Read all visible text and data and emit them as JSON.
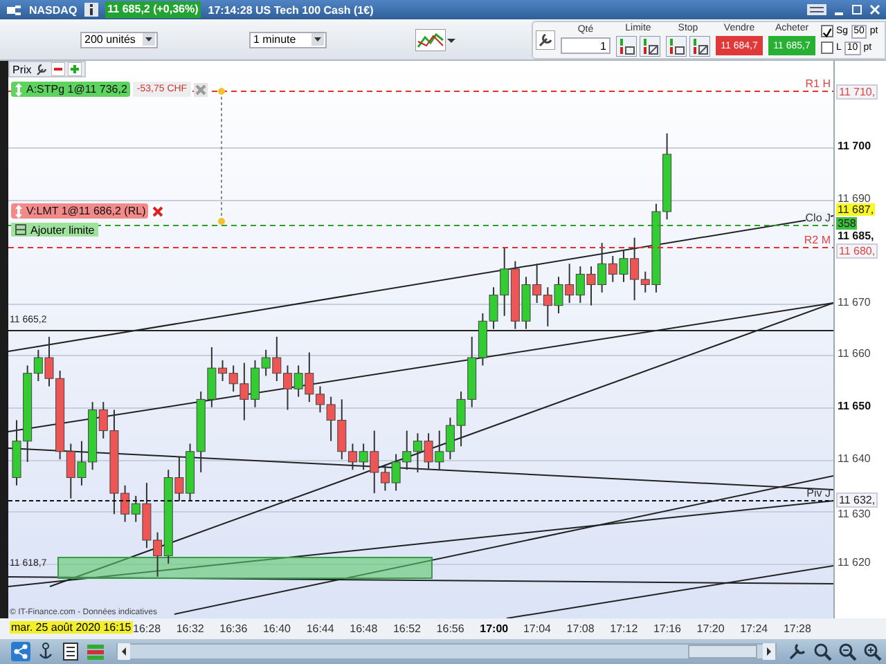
{
  "title_bar": {
    "instrument": "NASDAQ",
    "quote": "11 685,2 (+0,36%)",
    "description": "17:14:28 US Tech 100 Cash (1€)"
  },
  "toolbar": {
    "units": "200 unités",
    "interval": "1 minute",
    "qty_label": "Qté",
    "qty": "1",
    "limit_label": "Limite",
    "stop_label": "Stop",
    "sell_label": "Vendre",
    "sell_price": "11 684,7",
    "buy_label": "Acheter",
    "buy_price": "11 685,7",
    "options": [
      {
        "label": "Sg",
        "checked": true,
        "value": "50",
        "unit": "pt"
      },
      {
        "label": "L",
        "checked": false,
        "value": "10",
        "unit": "pt"
      }
    ]
  },
  "chart": {
    "price_label": "Prix",
    "orders": [
      {
        "kind": "stop",
        "text": "A:STPg 1@11 736,2",
        "pnl": "-53,75 CHF"
      },
      {
        "kind": "limit",
        "text": "V:LMT 1@11 686,2 (RL)"
      }
    ],
    "add_limit": "Ajouter limite",
    "side_labels": [
      "11 665,2",
      "11 618,7"
    ],
    "levels": [
      {
        "kind": "resistance",
        "label": "R1 H",
        "tag": "11 710,"
      },
      {
        "kind": "close",
        "label": "Clo J",
        "tag": "358"
      },
      {
        "kind": "resistance",
        "label": "R2 M",
        "tag": "11 680,"
      },
      {
        "kind": "pivot",
        "label": "Piv J",
        "tag": "11 632,"
      }
    ],
    "quote_tags": [
      {
        "kind": "ask",
        "text": "11 687,"
      },
      {
        "kind": "last",
        "text": "11 685,"
      }
    ],
    "price_ticks": [
      {
        "text": "11 700",
        "major": true
      },
      {
        "text": "11 690",
        "major": false
      },
      {
        "text": "11 670",
        "major": false
      },
      {
        "text": "11 660",
        "major": false
      },
      {
        "text": "11 650",
        "major": true
      },
      {
        "text": "11 640",
        "major": false
      },
      {
        "text": "11 630",
        "major": false
      },
      {
        "text": "11 620",
        "major": false
      }
    ],
    "copyright": "© IT-Finance.com - Données indicatives",
    "date": "mar. 25 août 2020 16:15",
    "time_ticks": [
      {
        "text": "16:28",
        "major": false
      },
      {
        "text": "16:32",
        "major": false
      },
      {
        "text": "16:36",
        "major": false
      },
      {
        "text": "16:40",
        "major": false
      },
      {
        "text": "16:44",
        "major": false
      },
      {
        "text": "16:48",
        "major": false
      },
      {
        "text": "16:52",
        "major": false
      },
      {
        "text": "16:56",
        "major": false
      },
      {
        "text": "17:00",
        "major": true
      },
      {
        "text": "17:04",
        "major": false
      },
      {
        "text": "17:08",
        "major": false
      },
      {
        "text": "17:12",
        "major": false
      },
      {
        "text": "17:16",
        "major": false
      },
      {
        "text": "17:20",
        "major": false
      },
      {
        "text": "17:24",
        "major": false
      },
      {
        "text": "17:28",
        "major": false
      }
    ]
  }
}
